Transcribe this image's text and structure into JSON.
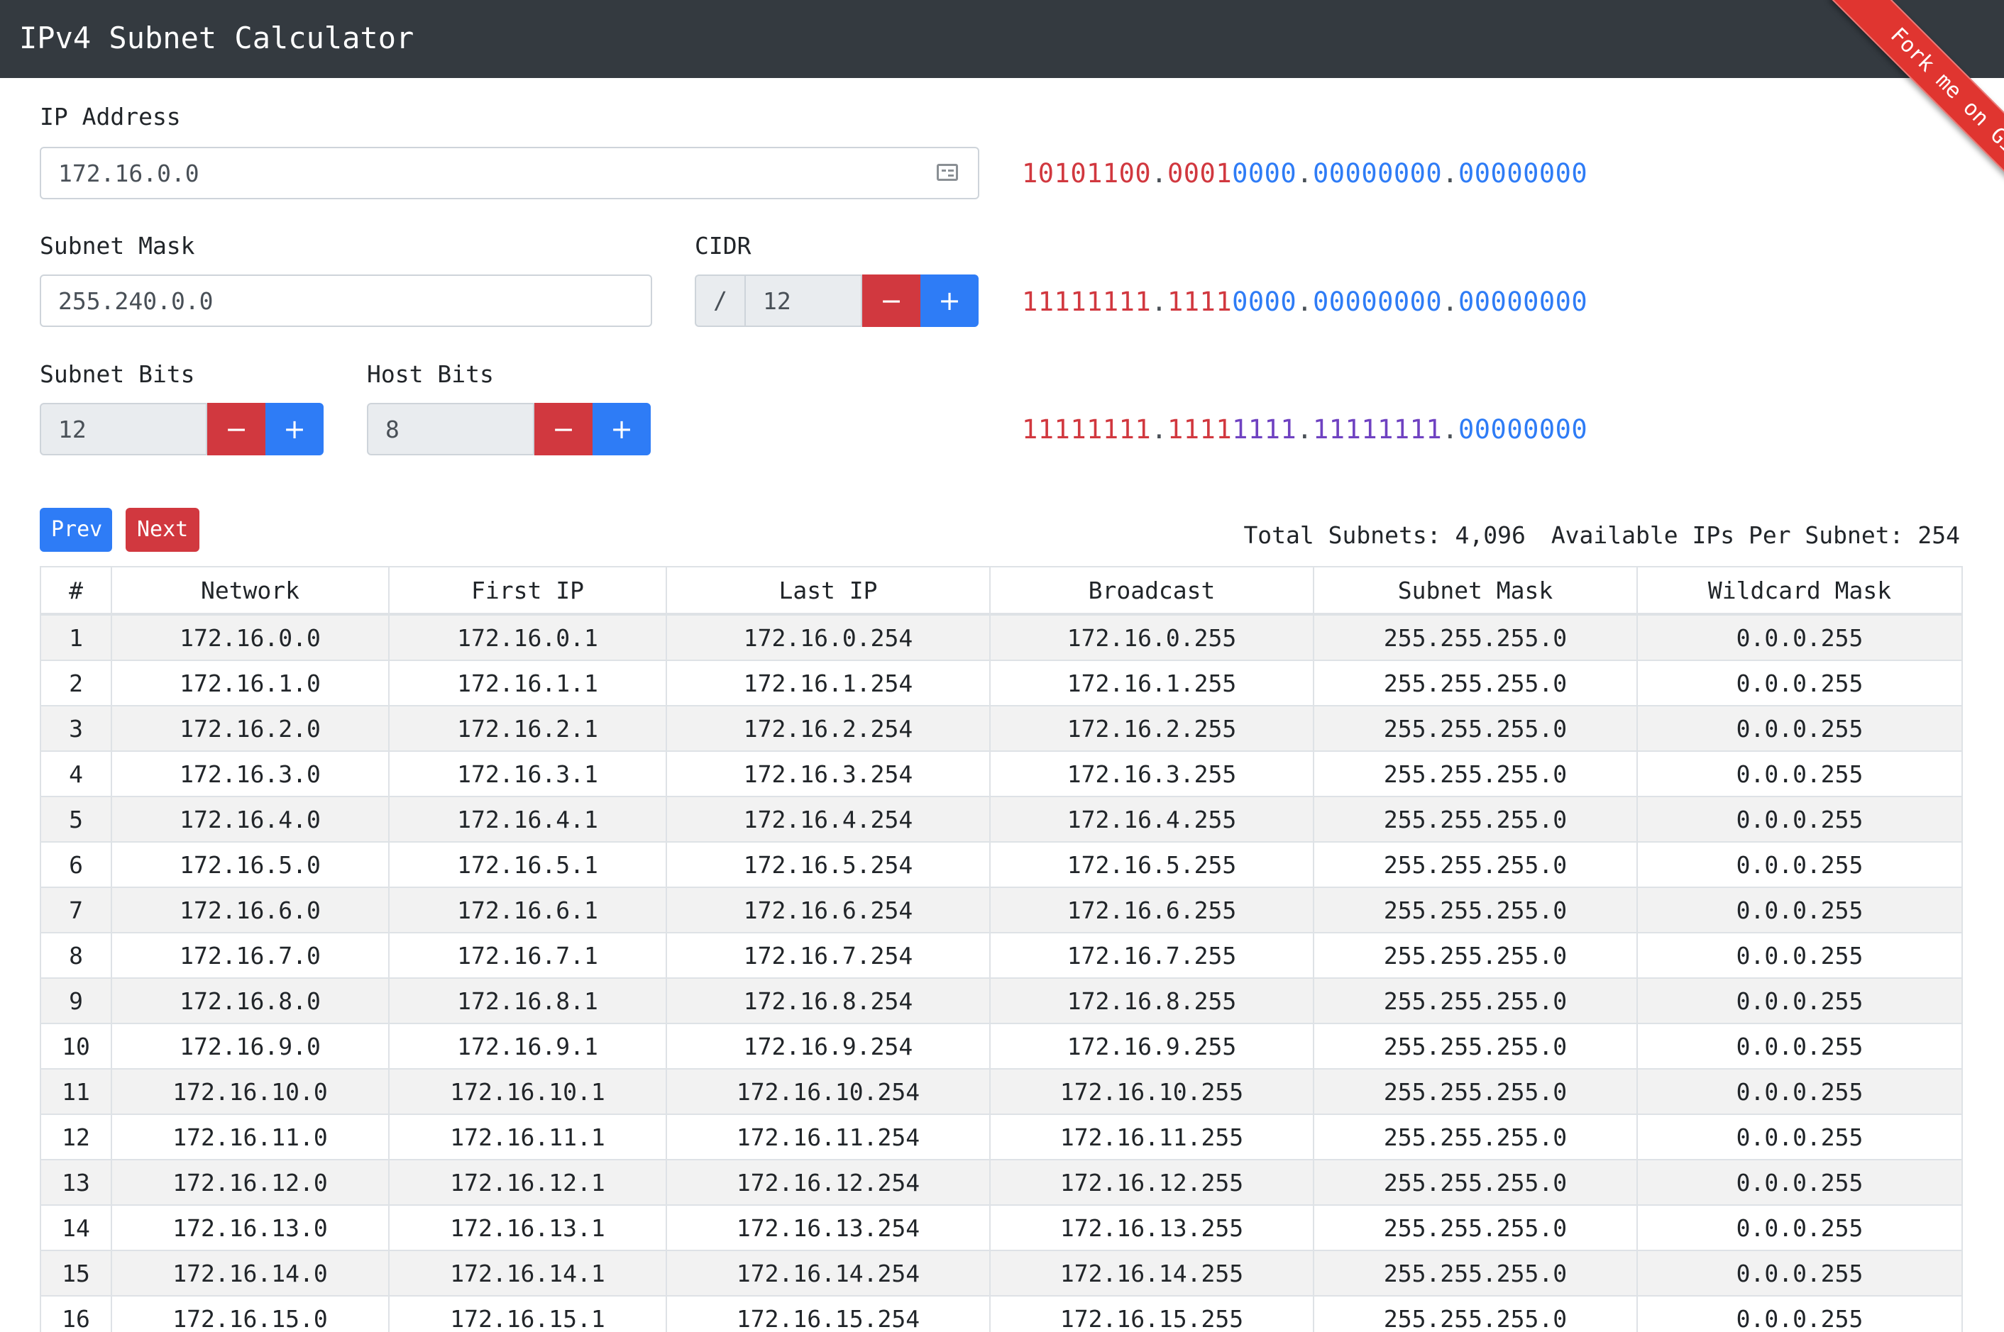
{
  "app": {
    "title": "IPv4 Subnet Calculator",
    "ribbon": "Fork me on GitHub!"
  },
  "ip": {
    "label": "IP Address",
    "value": "172.16.0.0",
    "icon": "id-card-icon",
    "binary": [
      {
        "text": "10101100",
        "color": "r"
      },
      {
        "text": ".",
        "color": "d"
      },
      {
        "text": "0001",
        "color": "r"
      },
      {
        "text": "0000",
        "color": "b"
      },
      {
        "text": ".",
        "color": "d"
      },
      {
        "text": "00000000",
        "color": "b"
      },
      {
        "text": ".",
        "color": "d"
      },
      {
        "text": "00000000",
        "color": "b"
      }
    ]
  },
  "mask": {
    "label": "Subnet Mask",
    "value": "255.240.0.0",
    "binary": [
      {
        "text": "11111111",
        "color": "r"
      },
      {
        "text": ".",
        "color": "d"
      },
      {
        "text": "1111",
        "color": "r"
      },
      {
        "text": "0000",
        "color": "b"
      },
      {
        "text": ".",
        "color": "d"
      },
      {
        "text": "00000000",
        "color": "b"
      },
      {
        "text": ".",
        "color": "d"
      },
      {
        "text": "00000000",
        "color": "b"
      }
    ]
  },
  "cidr": {
    "label": "CIDR",
    "prefix": "/",
    "value": "12",
    "minus": "−",
    "plus": "+"
  },
  "subnet_bits": {
    "label": "Subnet Bits",
    "value": "12",
    "minus": "−",
    "plus": "+"
  },
  "host_bits": {
    "label": "Host Bits",
    "value": "8",
    "minus": "−",
    "plus": "+",
    "binary": [
      {
        "text": "11111111",
        "color": "r"
      },
      {
        "text": ".",
        "color": "d"
      },
      {
        "text": "1111",
        "color": "r"
      },
      {
        "text": "1111",
        "color": "p"
      },
      {
        "text": ".",
        "color": "d"
      },
      {
        "text": "11111111",
        "color": "p"
      },
      {
        "text": ".",
        "color": "d"
      },
      {
        "text": "00000000",
        "color": "b"
      }
    ]
  },
  "pager": {
    "prev": "Prev",
    "next": "Next"
  },
  "summary": {
    "total_label": "Total Subnets:",
    "total_value": "4,096",
    "ips_label": "Available IPs Per Subnet:",
    "ips_value": "254"
  },
  "colors": {
    "red": "#d1383f",
    "blue": "#2e7cf6",
    "purple": "#6f42c1",
    "navbar": "#343a40",
    "ribbon": "#e03530"
  },
  "table": {
    "headers": [
      "#",
      "Network",
      "First IP",
      "Last IP",
      "Broadcast",
      "Subnet Mask",
      "Wildcard Mask"
    ],
    "rows": [
      [
        "1",
        "172.16.0.0",
        "172.16.0.1",
        "172.16.0.254",
        "172.16.0.255",
        "255.255.255.0",
        "0.0.0.255"
      ],
      [
        "2",
        "172.16.1.0",
        "172.16.1.1",
        "172.16.1.254",
        "172.16.1.255",
        "255.255.255.0",
        "0.0.0.255"
      ],
      [
        "3",
        "172.16.2.0",
        "172.16.2.1",
        "172.16.2.254",
        "172.16.2.255",
        "255.255.255.0",
        "0.0.0.255"
      ],
      [
        "4",
        "172.16.3.0",
        "172.16.3.1",
        "172.16.3.254",
        "172.16.3.255",
        "255.255.255.0",
        "0.0.0.255"
      ],
      [
        "5",
        "172.16.4.0",
        "172.16.4.1",
        "172.16.4.254",
        "172.16.4.255",
        "255.255.255.0",
        "0.0.0.255"
      ],
      [
        "6",
        "172.16.5.0",
        "172.16.5.1",
        "172.16.5.254",
        "172.16.5.255",
        "255.255.255.0",
        "0.0.0.255"
      ],
      [
        "7",
        "172.16.6.0",
        "172.16.6.1",
        "172.16.6.254",
        "172.16.6.255",
        "255.255.255.0",
        "0.0.0.255"
      ],
      [
        "8",
        "172.16.7.0",
        "172.16.7.1",
        "172.16.7.254",
        "172.16.7.255",
        "255.255.255.0",
        "0.0.0.255"
      ],
      [
        "9",
        "172.16.8.0",
        "172.16.8.1",
        "172.16.8.254",
        "172.16.8.255",
        "255.255.255.0",
        "0.0.0.255"
      ],
      [
        "10",
        "172.16.9.0",
        "172.16.9.1",
        "172.16.9.254",
        "172.16.9.255",
        "255.255.255.0",
        "0.0.0.255"
      ],
      [
        "11",
        "172.16.10.0",
        "172.16.10.1",
        "172.16.10.254",
        "172.16.10.255",
        "255.255.255.0",
        "0.0.0.255"
      ],
      [
        "12",
        "172.16.11.0",
        "172.16.11.1",
        "172.16.11.254",
        "172.16.11.255",
        "255.255.255.0",
        "0.0.0.255"
      ],
      [
        "13",
        "172.16.12.0",
        "172.16.12.1",
        "172.16.12.254",
        "172.16.12.255",
        "255.255.255.0",
        "0.0.0.255"
      ],
      [
        "14",
        "172.16.13.0",
        "172.16.13.1",
        "172.16.13.254",
        "172.16.13.255",
        "255.255.255.0",
        "0.0.0.255"
      ],
      [
        "15",
        "172.16.14.0",
        "172.16.14.1",
        "172.16.14.254",
        "172.16.14.255",
        "255.255.255.0",
        "0.0.0.255"
      ],
      [
        "16",
        "172.16.15.0",
        "172.16.15.1",
        "172.16.15.254",
        "172.16.15.255",
        "255.255.255.0",
        "0.0.0.255"
      ]
    ]
  }
}
